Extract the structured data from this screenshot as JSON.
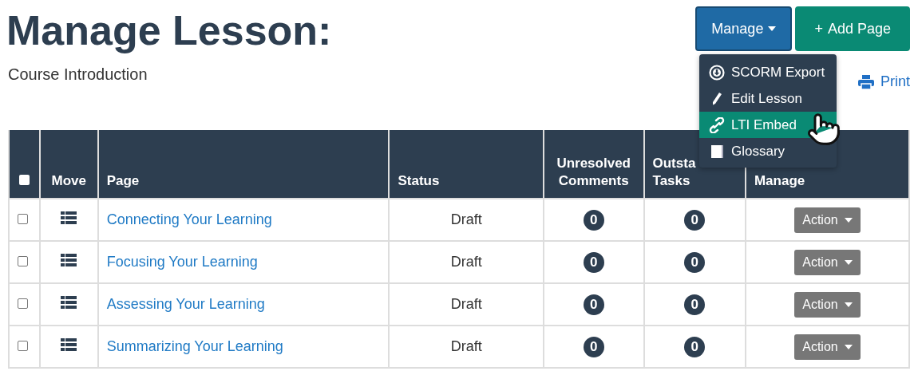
{
  "title": "Manage Lesson:",
  "subtitle": "Course Introduction",
  "buttons": [
    {
      "kind": "dropdown",
      "label": "Manage"
    },
    {
      "kind": "add",
      "sign": "+",
      "label": "Add Page"
    }
  ],
  "menu": {
    "items": [
      {
        "kind": "export",
        "label": "SCORM Export",
        "selected": false
      },
      {
        "kind": "edit",
        "label": "Edit Lesson",
        "selected": false
      },
      {
        "kind": "link",
        "label": "LTI Embed",
        "selected": true
      },
      {
        "kind": "book",
        "label": "Glossary",
        "selected": false
      }
    ]
  },
  "print": "Print",
  "table": {
    "columns": [
      {
        "kind": "check",
        "checked": false
      },
      {
        "kind": "text",
        "lines": [
          "Move"
        ]
      },
      {
        "kind": "text",
        "lines": [
          "Page"
        ]
      },
      {
        "kind": "text",
        "lines": [
          "Status"
        ]
      },
      {
        "kind": "text",
        "lines": [
          "Unresolved",
          "Comments"
        ]
      },
      {
        "kind": "text",
        "lines": [
          "Outsta",
          "Tasks"
        ]
      },
      {
        "kind": "text",
        "lines": [
          "Manage"
        ]
      }
    ],
    "rows": [
      {
        "checked": false,
        "page": "Connecting Your Learning",
        "status": "Draft",
        "comments": "0",
        "tasks": "0",
        "action": "Action"
      },
      {
        "checked": false,
        "page": "Focusing Your Learning",
        "status": "Draft",
        "comments": "0",
        "tasks": "0",
        "action": "Action"
      },
      {
        "checked": false,
        "page": "Assessing Your Learning",
        "status": "Draft",
        "comments": "0",
        "tasks": "0",
        "action": "Action"
      },
      {
        "checked": false,
        "page": "Summarizing Your Learning",
        "status": "Draft",
        "comments": "0",
        "tasks": "0",
        "action": "Action"
      }
    ]
  }
}
